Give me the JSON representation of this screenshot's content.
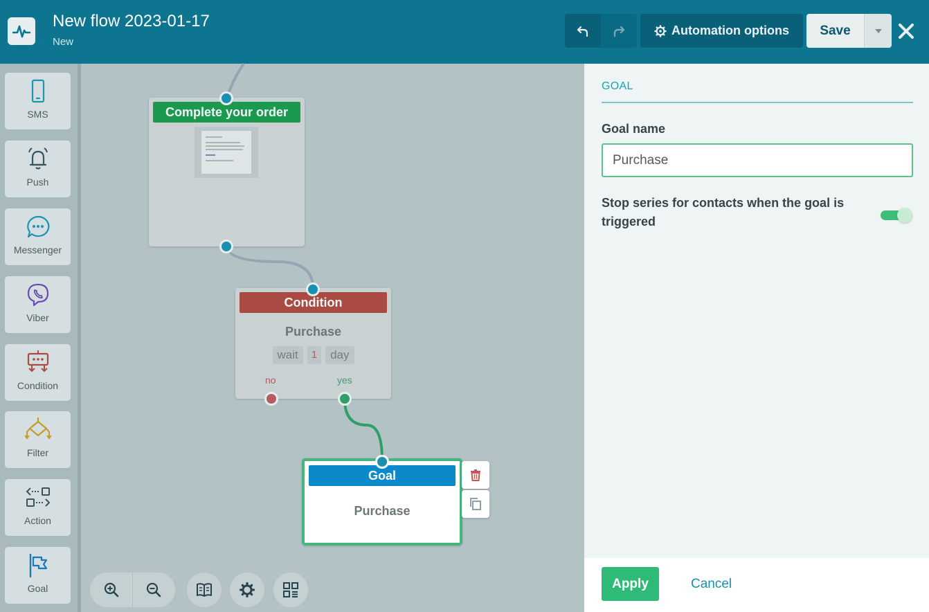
{
  "header": {
    "title": "New flow 2023-01-17",
    "status": "New",
    "automation_options_label": "Automation options",
    "save_label": "Save"
  },
  "sidebar": {
    "items": [
      {
        "label": "SMS",
        "icon": "phone-icon"
      },
      {
        "label": "Push",
        "icon": "bell-icon"
      },
      {
        "label": "Messenger",
        "icon": "chat-bubble-icon"
      },
      {
        "label": "Viber",
        "icon": "viber-icon"
      },
      {
        "label": "Condition",
        "icon": "condition-icon"
      },
      {
        "label": "Filter",
        "icon": "filter-icon"
      },
      {
        "label": "Action",
        "icon": "action-icon"
      },
      {
        "label": "Goal",
        "icon": "flag-icon"
      }
    ]
  },
  "canvas": {
    "email_node": {
      "title": "Complete your order"
    },
    "condition_node": {
      "header": "Condition",
      "title": "Purchase",
      "wait_word": "wait",
      "wait_value": "1",
      "wait_unit": "day",
      "branch_no": "no",
      "branch_yes": "yes"
    },
    "goal_node": {
      "header": "Goal",
      "title": "Purchase"
    }
  },
  "panel": {
    "heading": "GOAL",
    "goal_name_label": "Goal name",
    "goal_name_value": "Purchase",
    "stop_series_label": "Stop series for contacts when the goal is triggered",
    "stop_series_enabled": true,
    "apply_label": "Apply",
    "cancel_label": "Cancel"
  },
  "colors": {
    "topbar": "#0d7590",
    "email_header": "#1b9a4f",
    "condition_header": "#a94b43",
    "goal_header": "#0a8acb",
    "accent_green": "#2fbb77",
    "port_blue": "#1a8fb0"
  }
}
